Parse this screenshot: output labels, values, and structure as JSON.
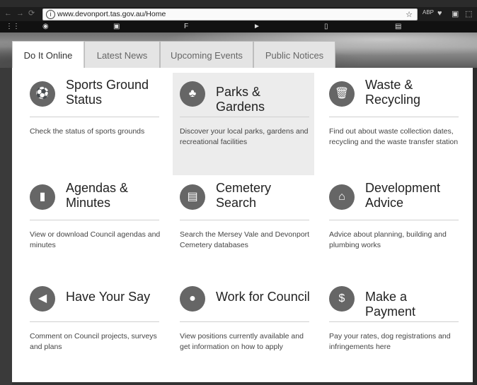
{
  "browser": {
    "url": "www.devonport.tas.gov.au/Home",
    "info_glyph": "i",
    "star_glyph": "☆",
    "nav_glyphs": "←→⟳",
    "extensions": [
      "ABP",
      "♥",
      "▣",
      "⬚"
    ],
    "bookmarks_glyphs": [
      "⋮⋮",
      "◉",
      "▣",
      "F",
      "►",
      "▯",
      "▤"
    ]
  },
  "tabs": [
    {
      "label": "Do It Online"
    },
    {
      "label": "Latest News"
    },
    {
      "label": "Upcoming Events"
    },
    {
      "label": "Public Notices"
    }
  ],
  "tiles": [
    {
      "title": "Sports Ground Status",
      "description": "Check the status of sports grounds",
      "icon": "ball-icon",
      "glyph": "⚽"
    },
    {
      "title": "Parks & Gardens",
      "description": "Discover your local parks, gardens and recreational facilities",
      "icon": "trees-icon",
      "glyph": "♣"
    },
    {
      "title": "Waste & Recycling",
      "description": "Find out about waste collection dates, recycling and the waste transfer station",
      "icon": "bin-icon",
      "glyph": "🗑"
    },
    {
      "title": "Agendas & Minutes",
      "description": "View or download Council agendas and minutes",
      "icon": "book-icon",
      "glyph": "▮"
    },
    {
      "title": "Cemetery Search",
      "description": "Search the Mersey Vale and Devonport Cemetery databases",
      "icon": "headstone-icon",
      "glyph": "▤"
    },
    {
      "title": "Development Advice",
      "description": "Advice about planning, building and plumbing works",
      "icon": "house-icon",
      "glyph": "⌂"
    },
    {
      "title": "Have Your Say",
      "description": "Comment on Council projects, surveys and plans",
      "icon": "megaphone-icon",
      "glyph": "◀"
    },
    {
      "title": "Work for Council",
      "description": "View positions currently available and get information on how to apply",
      "icon": "person-icon",
      "glyph": "●"
    },
    {
      "title": "Make a Payment",
      "description": "Pay your rates, dog registrations and infringements here",
      "icon": "dollar-icon",
      "glyph": "$"
    }
  ]
}
